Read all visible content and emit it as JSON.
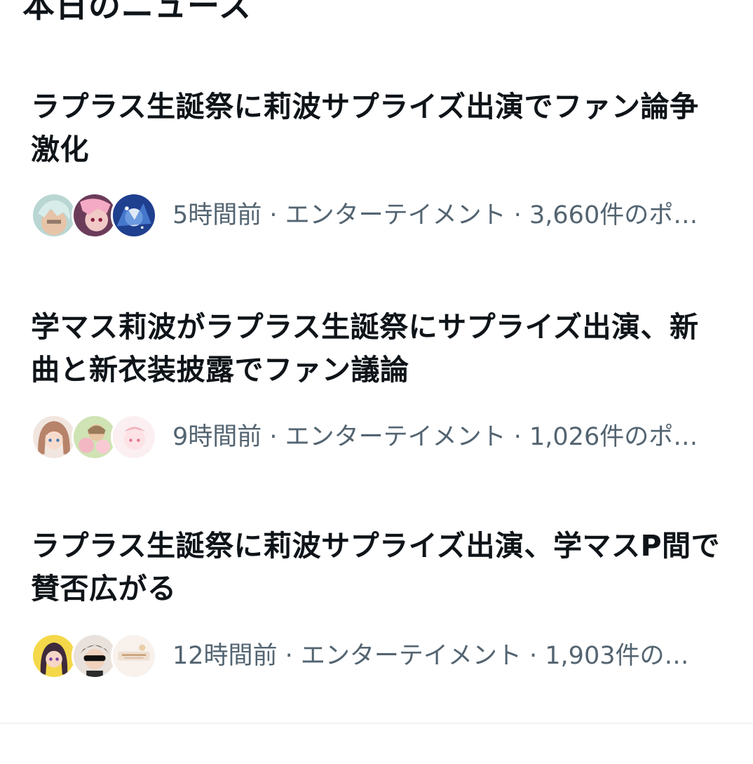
{
  "section": {
    "title": "本日のニュース"
  },
  "news": [
    {
      "headline": "ラプラス生誕祭に莉波サプライズ出演でファン論争激化",
      "meta": "5時間前 · エンターテイメント · 3,660件のポ…",
      "avatars": [
        "anime-avatar-icon",
        "anime-avatar-icon",
        "anime-avatar-icon"
      ]
    },
    {
      "headline": "学マス莉波がラプラス生誕祭にサプライズ出演、新曲と新衣装披露でファン議論",
      "meta": "9時間前 · エンターテイメント · 1,026件のポ…",
      "avatars": [
        "anime-avatar-icon",
        "anime-avatar-icon",
        "anime-avatar-icon"
      ]
    },
    {
      "headline": "ラプラス生誕祭に莉波サプライズ出演、学マスP間で賛否広がる",
      "meta": "12時間前 · エンターテイメント · 1,903件の…",
      "avatars": [
        "anime-avatar-icon",
        "anime-avatar-icon",
        "anime-avatar-icon"
      ]
    }
  ],
  "colors": {
    "text_primary": "#0f1419",
    "text_secondary": "#536471",
    "divider": "#eff3f4"
  }
}
